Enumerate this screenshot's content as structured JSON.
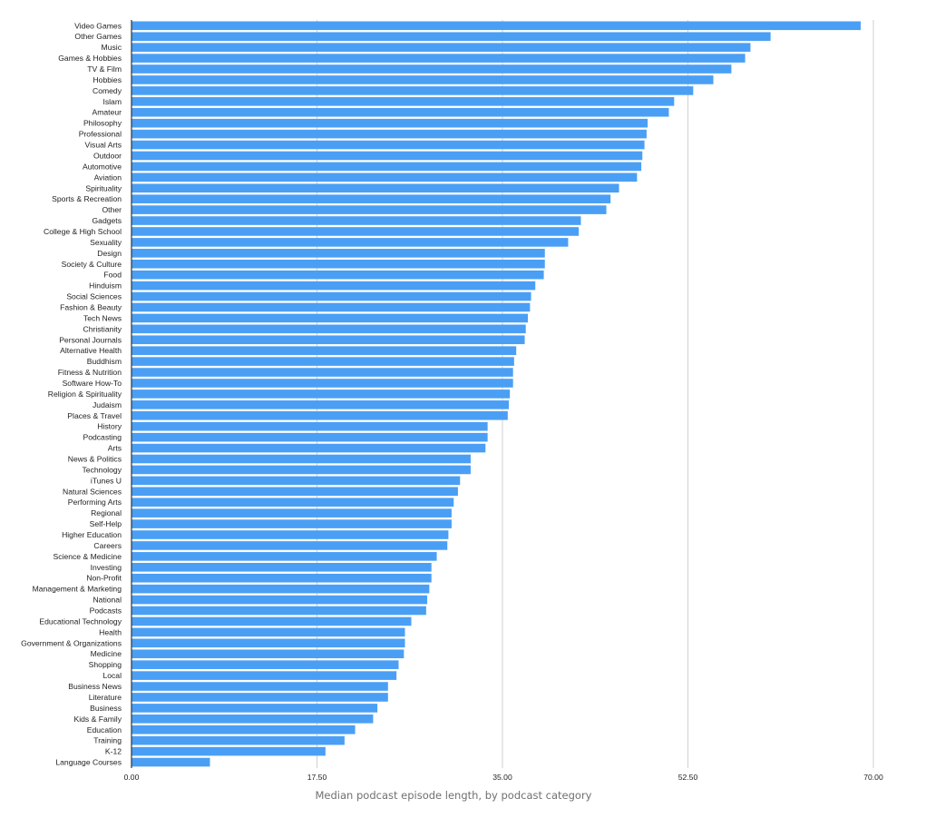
{
  "chart_data": {
    "type": "bar",
    "orientation": "horizontal",
    "title": "",
    "caption": "Median podcast episode length, by podcast category",
    "xlabel": "",
    "ylabel": "",
    "xlim": [
      0,
      70
    ],
    "xticks": [
      0,
      17.5,
      35,
      52.5,
      70
    ],
    "xtick_labels": [
      "0.00",
      "17.50",
      "35.00",
      "52.50",
      "70.00"
    ],
    "grid": "vertical",
    "legend": "none",
    "bar_color": "#4a9ff5",
    "categories": [
      "Video Games",
      "Other Games",
      "Music",
      "Games & Hobbies",
      "TV & Film",
      "Hobbies",
      "Comedy",
      "Islam",
      "Amateur",
      "Philosophy",
      "Professional",
      "Visual Arts",
      "Outdoor",
      "Automotive",
      "Aviation",
      "Spirituality",
      "Sports & Recreation",
      "Other",
      "Gadgets",
      "College & High School",
      "Sexuality",
      "Design",
      "Society & Culture",
      "Food",
      "Hinduism",
      "Social Sciences",
      "Fashion & Beauty",
      "Tech News",
      "Christianity",
      "Personal Journals",
      "Alternative Health",
      "Buddhism",
      "Fitness & Nutrition",
      "Software How-To",
      "Religion & Spirituality",
      "Judaism",
      "Places & Travel",
      "History",
      "Podcasting",
      "Arts",
      "News & Politics",
      "Technology",
      "iTunes U",
      "Natural Sciences",
      "Performing Arts",
      "Regional",
      "Self-Help",
      "Higher Education",
      "Careers",
      "Science & Medicine",
      "Investing",
      "Non-Profit",
      "Management & Marketing",
      "National",
      "Podcasts",
      "Educational Technology",
      "Health",
      "Government & Organizations",
      "Medicine",
      "Shopping",
      "Local",
      "Business News",
      "Literature",
      "Business",
      "Kids & Family",
      "Education",
      "Training",
      "K-12",
      "Language Courses"
    ],
    "values": [
      68.8,
      60.3,
      58.4,
      57.9,
      56.6,
      54.9,
      53.0,
      51.2,
      50.7,
      48.7,
      48.6,
      48.4,
      48.2,
      48.1,
      47.7,
      46.0,
      45.2,
      44.8,
      42.4,
      42.2,
      41.2,
      39.0,
      39.0,
      38.9,
      38.1,
      37.7,
      37.6,
      37.4,
      37.2,
      37.1,
      36.3,
      36.1,
      36.0,
      36.0,
      35.7,
      35.6,
      35.5,
      33.6,
      33.6,
      33.4,
      32.0,
      32.0,
      31.0,
      30.8,
      30.4,
      30.2,
      30.2,
      29.9,
      29.8,
      28.8,
      28.3,
      28.3,
      28.1,
      27.9,
      27.8,
      26.4,
      25.8,
      25.8,
      25.7,
      25.2,
      25.0,
      24.2,
      24.2,
      23.2,
      22.8,
      21.1,
      20.1,
      18.3,
      7.4
    ]
  }
}
